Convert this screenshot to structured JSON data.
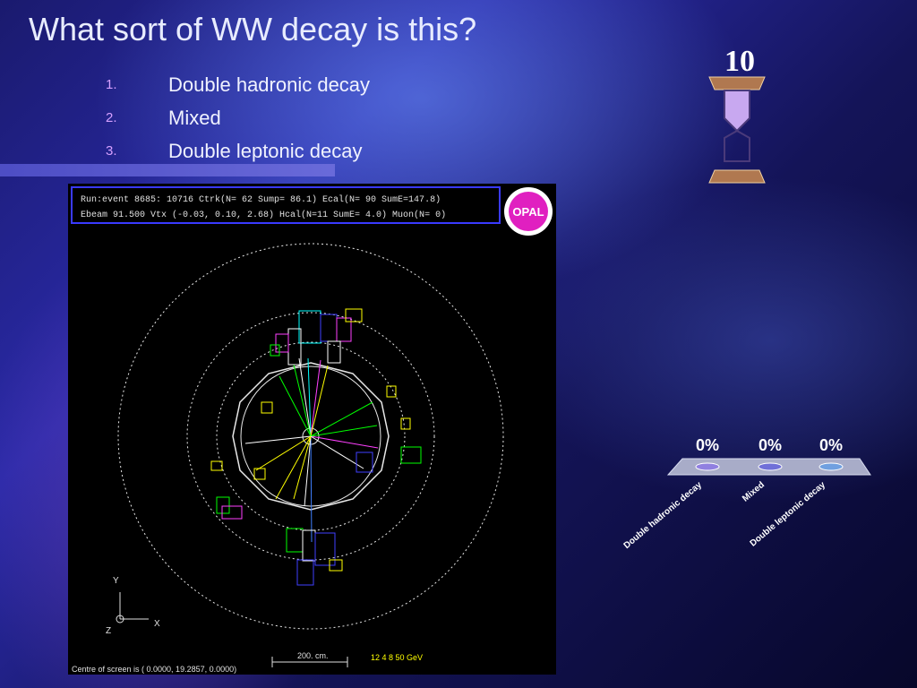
{
  "slide": {
    "title": "What sort of WW decay is this?",
    "options": [
      {
        "number": "1.",
        "text": "Double hadronic decay"
      },
      {
        "number": "2.",
        "text": "Mixed"
      },
      {
        "number": "3.",
        "text": "Double leptonic decay"
      }
    ],
    "timer": "10"
  },
  "event_display": {
    "header_line1": "Run:event 8685: 10716    Ctrk(N= 62 Sump= 86.1) Ecal(N= 90 SumE=147.8)",
    "header_line2": "Ebeam 91.500 Vtx (-0.03, 0.10, 2.68) Hcal(N=11 SumE=  4.0) Muon(N= 0)",
    "logo_text": "OPAL",
    "scale_label": "200. cm.",
    "energy_scale": "12 4 8 50 GeV",
    "centre_text": "Centre of screen is (   0.0000,  19.2857,   0.0000)",
    "axis_y": "Y",
    "axis_x": "X",
    "axis_z": "Z"
  },
  "colors": {
    "accent_purple": "#c8a8f0",
    "hourglass_sand": "#a8704a",
    "event_frame": "#2828ff",
    "chart_platform": "#a8acc8"
  },
  "chart_data": {
    "type": "bar",
    "categories": [
      "Double hadronic decay",
      "Mixed",
      "Double leptonic decay"
    ],
    "values": [
      0,
      0,
      0
    ],
    "value_labels": [
      "0%",
      "0%",
      "0%"
    ],
    "ylim": [
      0,
      100
    ]
  }
}
